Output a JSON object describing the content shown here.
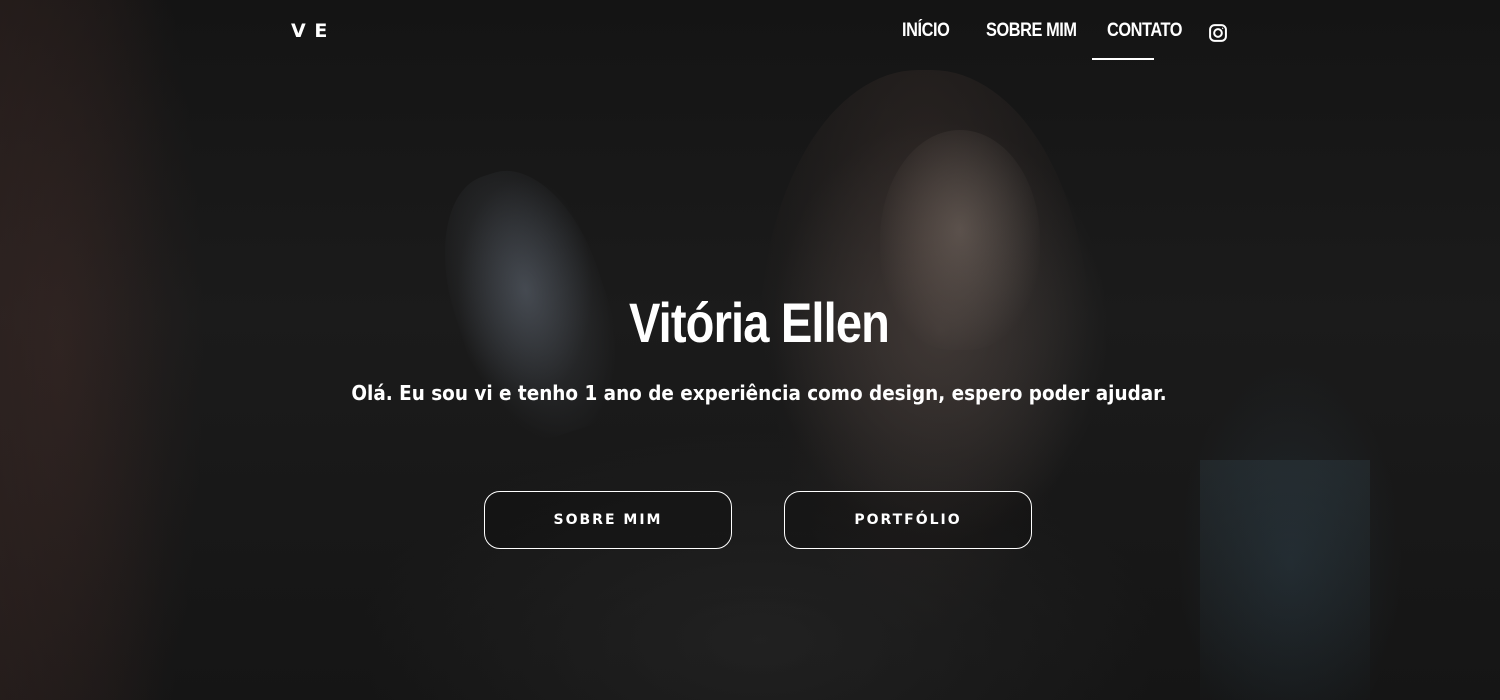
{
  "nav": {
    "logo": "V E",
    "items": [
      {
        "label": "INÍCIO"
      },
      {
        "label": "SOBRE MIM"
      },
      {
        "label": "CONTATO",
        "active": true
      }
    ],
    "social_icon": "instagram-icon"
  },
  "hero": {
    "title": "Vitória Ellen",
    "subtitle": "Olá. Eu sou vi e tenho 1 ano de experiência como design, espero poder ajudar.",
    "buttons": [
      {
        "label": "SOBRE MIM"
      },
      {
        "label": "PORTFÓLIO"
      }
    ]
  },
  "colors": {
    "text": "#ffffff",
    "background": "#141414"
  }
}
